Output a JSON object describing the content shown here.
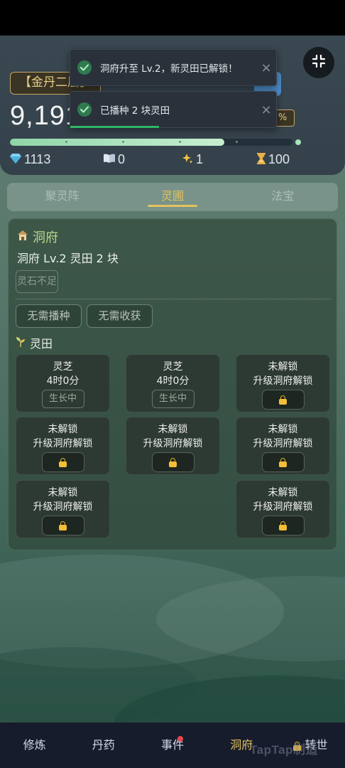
{
  "header": {
    "realm": "【金丹二层】",
    "cultivation_value": "9,191",
    "progress_percent_label": "%",
    "progress": 0.76,
    "stats": {
      "spirit_stones": "1113",
      "books": "0",
      "stars": "1",
      "time": "100"
    }
  },
  "toasts": [
    {
      "message": "洞府升至 Lv.2，新灵田已解锁！",
      "close": "×"
    },
    {
      "message": "已播种 2 块灵田",
      "close": "×"
    }
  ],
  "tabs": [
    "聚灵阵",
    "灵圃",
    "法宝"
  ],
  "dongfu": {
    "title": "洞府",
    "info": "洞府 Lv.2   灵田 2 块",
    "upgrade_button": "灵石不足",
    "no_sow_button": "无需播种",
    "no_harvest_button": "无需收获"
  },
  "lingtian": {
    "title": "灵田",
    "plots": [
      {
        "name": "灵芝",
        "time": "4时0分",
        "status": "生长中"
      },
      {
        "name": "灵芝",
        "time": "4时0分",
        "status": "生长中"
      },
      {
        "name": "未解锁",
        "hint": "升级洞府解锁"
      },
      {
        "name": "未解锁",
        "hint": "升级洞府解锁"
      },
      {
        "name": "未解锁",
        "hint": "升级洞府解锁"
      },
      {
        "name": "未解锁",
        "hint": "升级洞府解锁"
      },
      {
        "name": "未解锁",
        "hint": "升级洞府解锁"
      },
      {
        "name": "未解锁",
        "hint": "升级洞府解锁"
      }
    ]
  },
  "nav": [
    "修炼",
    "丹药",
    "事件",
    "洞府",
    "转世"
  ],
  "watermark": "TapTap制造",
  "colors": {
    "accent_gold": "#e2c25f",
    "title_green": "#b9d88d",
    "toast_success": "#2fb564",
    "notification_red": "#e5484d"
  }
}
